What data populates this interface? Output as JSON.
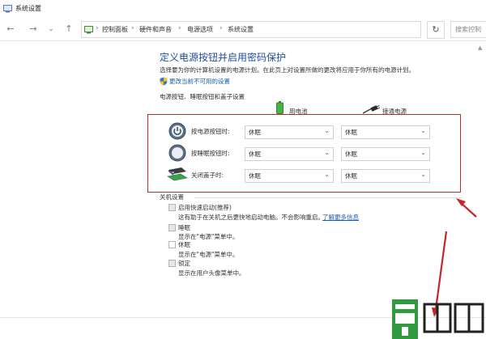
{
  "window": {
    "title": "系统设置"
  },
  "address": {
    "crumbs": [
      "控制面板",
      "硬件和声音",
      "电源选项",
      "系统设置"
    ],
    "search_placeholder": "搜索控制"
  },
  "nav": {
    "back": "←",
    "forward": "→",
    "recent": "⌄",
    "up": "↑",
    "refresh": "↻",
    "dropdown": "⌄"
  },
  "content": {
    "title": "定义电源按钮并启用密码保护",
    "description": "选择要为你的计算机设置的电源计划。在此页上对设置所做的更改将应用于你所有的电源计划。",
    "change_link": "更改当前不可用的设置",
    "section_buttons": "电源按钮、睡眠按钮和盖子设置",
    "col_battery": "用电池",
    "col_plugged": "接通电源",
    "rows": [
      {
        "label": "按电源按钮时:",
        "icon": "power-button-icon",
        "battery": "休眠",
        "plugged": "休眠"
      },
      {
        "label": "按睡眠按钮时:",
        "icon": "sleep-button-icon",
        "battery": "休眠",
        "plugged": "休眠"
      },
      {
        "label": "关闭盖子时:",
        "icon": "lid-close-icon",
        "battery": "休眠",
        "plugged": "休眠"
      }
    ],
    "section_shutdown": "关机设置",
    "options": [
      {
        "label": "启用快速启动(推荐)",
        "desc": "这有助于在关机之后更快地启动电脑。不会影响重启。",
        "link": "了解更多信息",
        "checked": false
      },
      {
        "label": "睡眠",
        "desc": "显示在\"电源\"菜单中。",
        "checked": false
      },
      {
        "label": "休眠",
        "desc": "显示在\"电源\"菜单中。",
        "checked": false
      },
      {
        "label": "锁定",
        "desc": "显示在用户头像菜单中。",
        "checked": false
      }
    ]
  },
  "colors": {
    "title_blue": "#1e4c9a",
    "link_blue": "#1a5fb4",
    "highlight_red": "#b2302f"
  }
}
